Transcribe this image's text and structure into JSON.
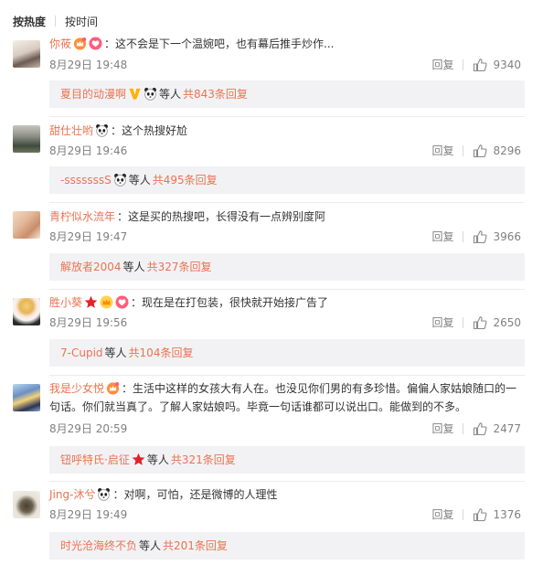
{
  "tabs": [
    {
      "label": "按热度",
      "active": true
    },
    {
      "label": "按时间",
      "active": false
    }
  ],
  "reply_label": "回复",
  "etc_label": "等人",
  "comments": [
    {
      "username": "你莜",
      "text": "：这不会是下一个温婉吧，也有幕后推手炒作...",
      "time": "8月29日 19:48",
      "likes": "9340",
      "sub_name": "夏目的动漫啊",
      "sub_total": "共843条回复",
      "badges": [
        "vip-crown-icon",
        "heart-icon"
      ],
      "sub_badges": [
        "v-badge-icon",
        "panda-icon"
      ]
    },
    {
      "username": "甜仕壮哟",
      "text": "：这个热搜好尬",
      "time": "8月29日 19:46",
      "likes": "8296",
      "sub_name": "-sssssssS",
      "sub_total": "共495条回复",
      "badges": [
        "panda-icon"
      ],
      "sub_badges": [
        "panda-icon"
      ]
    },
    {
      "username": "青柠似水流年",
      "text": "：这是买的热搜吧，长得没有一点辨别度阿",
      "time": "8月29日 19:47",
      "likes": "3966",
      "sub_name": "解放者2004",
      "sub_total": "共327条回复",
      "badges": [],
      "sub_badges": []
    },
    {
      "username": "胜小葵",
      "text": "：现在是在打包装，很快就开始接广告了",
      "time": "8月29日 19:56",
      "likes": "2650",
      "sub_name": "7-Cupid",
      "sub_total": "共104条回复",
      "badges": [
        "star-icon",
        "crown-icon",
        "heart-icon"
      ],
      "sub_badges": []
    },
    {
      "username": "我是少女悦",
      "text": "：生活中这样的女孩大有人在。也没见你们男的有多珍惜。偏偏人家姑娘随口的一句话。你们就当真了。了解人家姑娘吗。毕竟一句话谁都可以说出口。能做到的不多。",
      "time": "8月29日 20:59",
      "likes": "2477",
      "sub_name": "钮呼特氏·启征",
      "sub_total": "共321条回复",
      "badges": [
        "vip-crown-icon"
      ],
      "sub_badges": [
        "star-icon"
      ]
    },
    {
      "username": "Jing-沐兮",
      "text": "：对啊，可怕，还是微博的人理性",
      "time": "8月29日 19:49",
      "likes": "1376",
      "sub_name": "时光沧海终不负",
      "sub_total": "共201条回复",
      "badges": [
        "panda-icon"
      ],
      "sub_badges": []
    }
  ],
  "colors": {
    "username": "#eb7350",
    "meta": "#808080",
    "sub_bg": "#f2f2f5",
    "text": "#333333"
  }
}
